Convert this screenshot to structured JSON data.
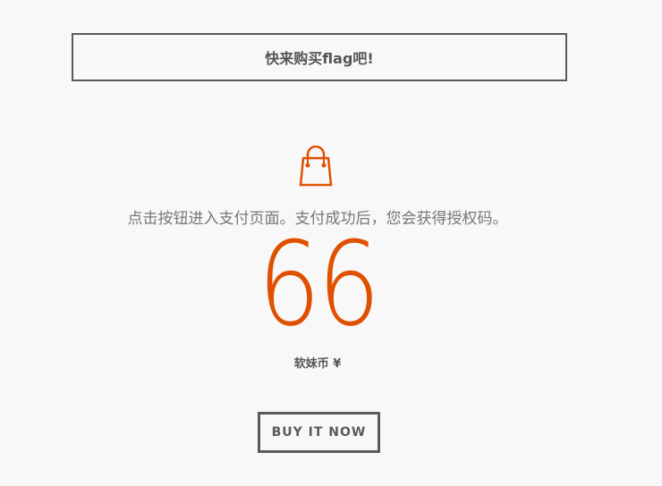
{
  "banner": {
    "title": "快来购买flag吧!"
  },
  "product": {
    "icon": "shopping-bag-icon",
    "description": "点击按钮进入支付页面。支付成功后，您会获得授权码。",
    "price": "66",
    "currency": "软妹币 ¥",
    "accent_color": "#e05000"
  },
  "actions": {
    "buy_label": "BUY IT NOW"
  }
}
